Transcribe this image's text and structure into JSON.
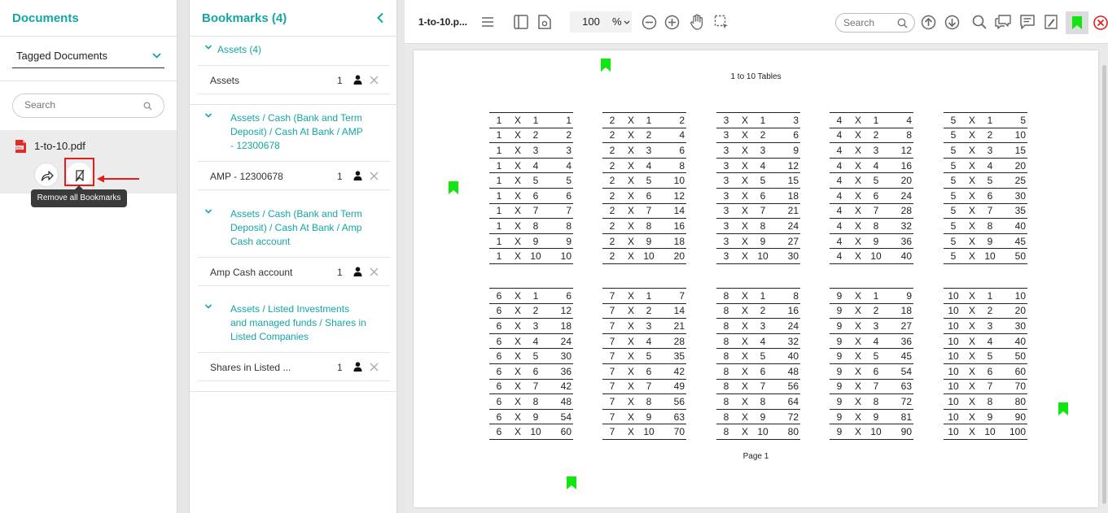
{
  "left": {
    "title": "Documents",
    "dropdown_value": "Tagged Documents",
    "search_placeholder": "Search",
    "file_name": "1-to-10.pdf",
    "tooltip": "Remove all Bookmarks"
  },
  "bookmarks": {
    "title": "Bookmarks (4)",
    "groups": [
      {
        "label": "Assets (4)",
        "items": [
          {
            "name": "Assets",
            "count": "1"
          }
        ]
      },
      {
        "label": "Assets / Cash (Bank and Term Deposit) / Cash At Bank / AMP - 12300678",
        "items": [
          {
            "name": "AMP - 12300678",
            "count": "1"
          }
        ]
      },
      {
        "label": "Assets / Cash (Bank and Term Deposit) / Cash At Bank / Amp Cash account",
        "items": [
          {
            "name": "Amp Cash account",
            "count": "1"
          }
        ]
      },
      {
        "label": "Assets / Listed Investments and managed funds / Shares in Listed Companies",
        "items": [
          {
            "name": "Shares in Listed ...",
            "count": "1"
          }
        ]
      }
    ]
  },
  "viewer": {
    "doc_tab": "1-to-10.p...",
    "zoom": "100",
    "zoom_unit": "%",
    "search_placeholder": "Search",
    "page_title": "1 to 10 Tables",
    "page_label": "Page 1"
  },
  "tables": {
    "bases": [
      1,
      2,
      3,
      4,
      5,
      6,
      7,
      8,
      9,
      10
    ],
    "multipliers": [
      1,
      2,
      3,
      4,
      5,
      6,
      7,
      8,
      9,
      10
    ],
    "operator": "X"
  },
  "colors": {
    "accent": "#14a5a5",
    "highlight": "#e01e1e",
    "bookmark_flag": "#11e611"
  }
}
